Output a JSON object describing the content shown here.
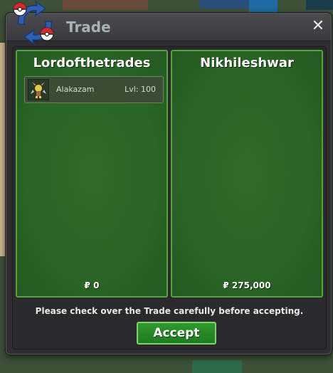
{
  "window": {
    "title": "Trade",
    "close_label": "✕"
  },
  "trade": {
    "left": {
      "player_name": "Lordofthetrades",
      "items": [
        {
          "name": "Alakazam",
          "level": "Lvl: 100"
        }
      ],
      "money": "₽ 0"
    },
    "right": {
      "player_name": "Nikhileshwar",
      "money": "₽ 275,000"
    },
    "note": "Please check over the Trade carefully before accepting.",
    "accept_label": "Accept"
  },
  "colors": {
    "panel_border": "#55a33f",
    "panel_fill": "#2a6426",
    "accept_fill": "#2f9a2f",
    "window_bg": "#2e2e30"
  },
  "icons": [
    "trade-logo-icon",
    "close-icon",
    "alakazam-sprite-icon"
  ]
}
